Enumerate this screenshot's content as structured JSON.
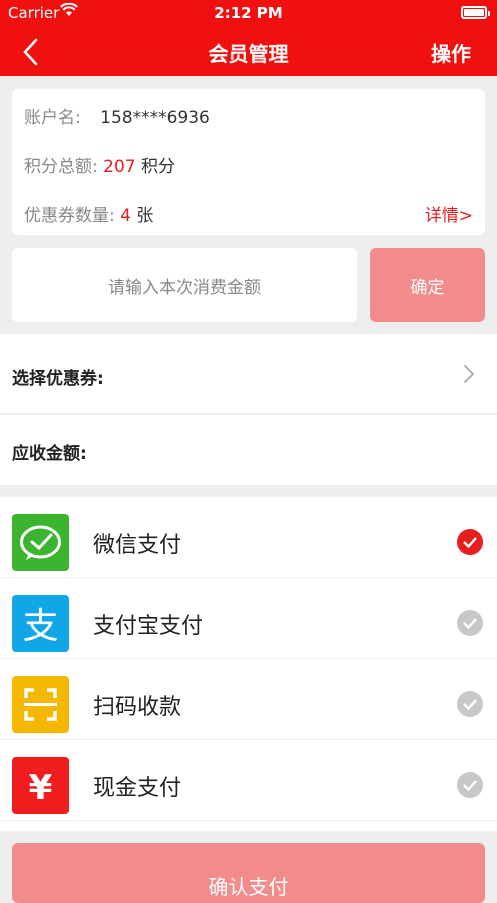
{
  "status": {
    "carrier": "Carrier",
    "time": "2:12 PM"
  },
  "nav": {
    "title": "会员管理",
    "action": "操作"
  },
  "account": {
    "name_label": "账户名:",
    "name_value": "158****6936",
    "points_label": "积分总额:",
    "points_value": "207",
    "points_unit": "积分",
    "coupons_label": "优惠券数量:",
    "coupons_value": "4",
    "coupons_unit": "张",
    "detail_link": "详情>"
  },
  "amount": {
    "placeholder": "请输入本次消费金额",
    "confirm_label": "确定"
  },
  "coupon_select": {
    "label": "选择优惠券:"
  },
  "receivable": {
    "label": "应收金额:"
  },
  "payments": [
    {
      "label": "微信支付",
      "selected": true,
      "icon": "wechat-pay-icon",
      "color": "#3bb430"
    },
    {
      "label": "支付宝支付",
      "selected": false,
      "icon": "alipay-icon",
      "color": "#11a6e8"
    },
    {
      "label": "扫码收款",
      "selected": false,
      "icon": "scan-icon",
      "color": "#f5b800"
    },
    {
      "label": "现金支付",
      "selected": false,
      "icon": "cash-yen-icon",
      "color": "#ef1d1d"
    }
  ],
  "submit": {
    "label": "确认支付"
  },
  "colors": {
    "primary": "#f01010",
    "disabled_button": "#f28c8c",
    "accent_text": "#e81d1d"
  }
}
